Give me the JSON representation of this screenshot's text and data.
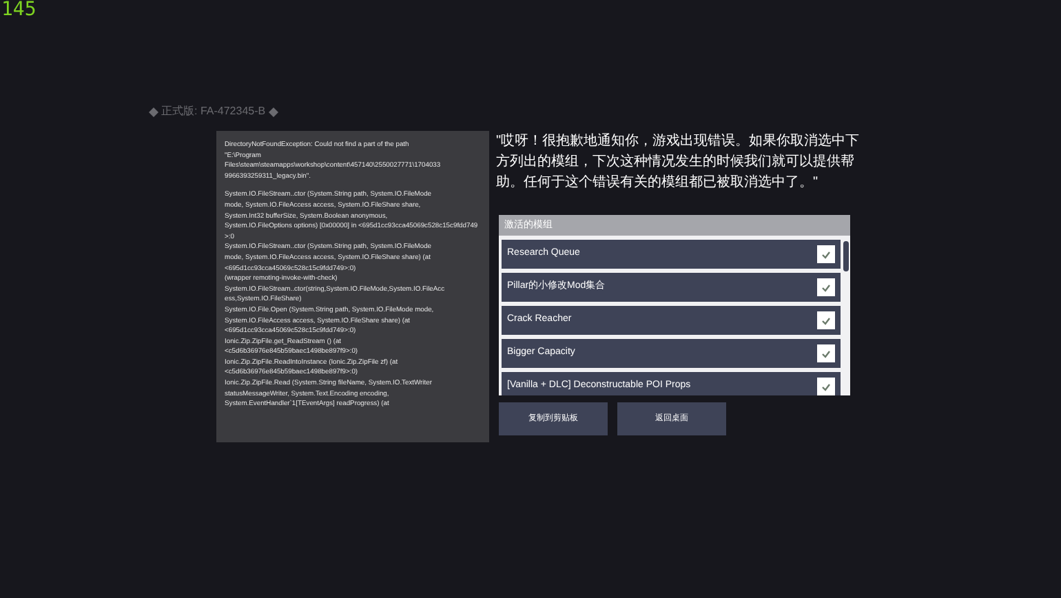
{
  "fps_counter": "145",
  "version_label": "正式版: FA-472345-B",
  "stack_trace": [
    "DirectoryNotFoundException: Could not find a part of the path\n\"E:\\Program\nFiles\\steam\\steamapps\\workshop\\content\\457140\\2550027771\\1704033\n9966393259311_legacy.bin\".",
    "System.IO.FileStream..ctor (System.String path, System.IO.FileMode\nmode, System.IO.FileAccess access, System.IO.FileShare share,\nSystem.Int32 bufferSize, System.Boolean anonymous,\nSystem.IO.FileOptions options) [0x00000] in <695d1cc93cca45069c528c15c9fdd749>:0\nSystem.IO.FileStream..ctor (System.String path, System.IO.FileMode\nmode, System.IO.FileAccess access, System.IO.FileShare share) (at\n<695d1cc93cca45069c528c15c9fdd749>:0)\n(wrapper remoting-invoke-with-check)\nSystem.IO.FileStream..ctor(string,System.IO.FileMode,System.IO.FileAcc\ness,System.IO.FileShare)\nSystem.IO.File.Open (System.String path, System.IO.FileMode mode,\nSystem.IO.FileAccess access, System.IO.FileShare share) (at\n<695d1cc93cca45069c528c15c9fdd749>:0)\nIonic.Zip.ZipFile.get_ReadStream () (at\n<c5d6b36976e845b59baec1498be897f9>:0)\nIonic.Zip.ZipFile.ReadIntoInstance (Ionic.Zip.ZipFile zf) (at\n<c5d6b36976e845b59baec1498be897f9>:0)\nIonic.Zip.ZipFile.Read (System.String fileName, System.IO.TextWriter\nstatusMessageWriter, System.Text.Encoding encoding,\nSystem.EventHandler`1[TEventArgs] readProgress) (at"
  ],
  "message": "\"哎呀！很抱歉地通知你，游戏出现错误。如果你取消选中下方列出的模组，下次这种情况发生的时候我们就可以提供帮助。任何于这个错误有关的模组都已被取消选中了。\"",
  "mod_list": {
    "title": "激活的模组",
    "mods": [
      {
        "name": "Research Queue",
        "checked": true
      },
      {
        "name": "Pillar的小修改Mod集合",
        "checked": true
      },
      {
        "name": "Crack Reacher",
        "checked": true
      },
      {
        "name": "Bigger Capacity",
        "checked": true
      },
      {
        "name": "[Vanilla + DLC] Deconstructable POI Props",
        "checked": true
      }
    ]
  },
  "buttons": [
    "复制到剪贴板",
    "返回桌面"
  ]
}
